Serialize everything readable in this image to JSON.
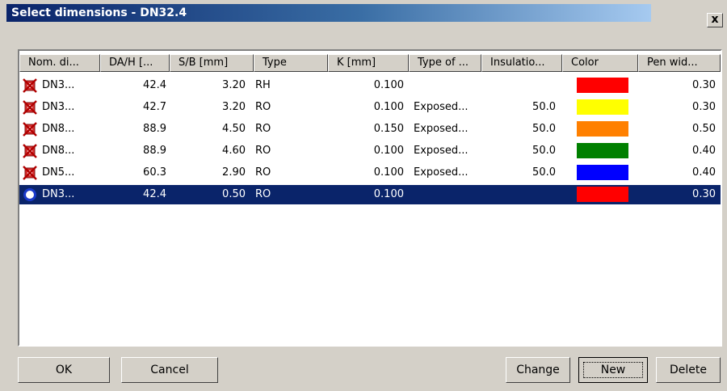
{
  "window": {
    "title": "Select dimensions - DN32.4",
    "close_label": "x"
  },
  "columns": [
    "Nom. di...",
    "DA/H [...",
    "S/B [mm]",
    "Type",
    "K [mm]",
    "Type of ...",
    "Insulatio...",
    "Color",
    "Pen wid..."
  ],
  "rows": [
    {
      "icon": "crossed-pipe-icon",
      "nom": "DN3...",
      "da": "42.4",
      "sb": "3.20",
      "type": "RH",
      "k": "0.100",
      "type_of": "",
      "insulation": "",
      "color": "#ff0000",
      "pen": "0.30",
      "selected": false
    },
    {
      "icon": "crossed-pipe-icon",
      "nom": "DN3...",
      "da": "42.7",
      "sb": "3.20",
      "type": "RO",
      "k": "0.100",
      "type_of": "Exposed...",
      "insulation": "50.0",
      "color": "#ffff00",
      "pen": "0.30",
      "selected": false
    },
    {
      "icon": "crossed-pipe-icon",
      "nom": "DN8...",
      "da": "88.9",
      "sb": "4.50",
      "type": "RO",
      "k": "0.150",
      "type_of": "Exposed...",
      "insulation": "50.0",
      "color": "#ff8000",
      "pen": "0.50",
      "selected": false
    },
    {
      "icon": "crossed-pipe-icon",
      "nom": "DN8...",
      "da": "88.9",
      "sb": "4.60",
      "type": "RO",
      "k": "0.100",
      "type_of": "Exposed...",
      "insulation": "50.0",
      "color": "#008000",
      "pen": "0.40",
      "selected": false
    },
    {
      "icon": "crossed-pipe-icon",
      "nom": "DN5...",
      "da": "60.3",
      "sb": "2.90",
      "type": "RO",
      "k": "0.100",
      "type_of": "Exposed...",
      "insulation": "50.0",
      "color": "#0000ff",
      "pen": "0.40",
      "selected": false
    },
    {
      "icon": "circle-icon",
      "nom": "DN3...",
      "da": "42.4",
      "sb": "0.50",
      "type": "RO",
      "k": "0.100",
      "type_of": "",
      "insulation": "",
      "color": "#ff0000",
      "pen": "0.30",
      "selected": true
    }
  ],
  "buttons": {
    "ok": "OK",
    "cancel": "Cancel",
    "change": "Change",
    "new": "New",
    "delete": "Delete"
  },
  "colors": {
    "selection": "#0a246a",
    "face": "#d4d0c8"
  }
}
